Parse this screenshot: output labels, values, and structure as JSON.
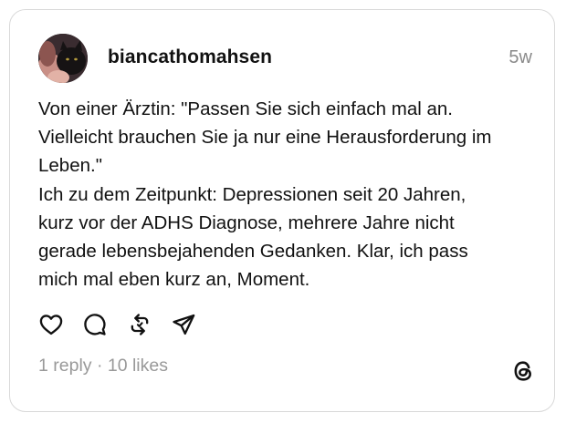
{
  "post": {
    "username": "biancathomahsen",
    "timestamp": "5w",
    "avatar_icon": "profile-photo-cat",
    "text_lines": [
      "Von einer Ärztin: \"Passen Sie sich einfach mal an.",
      "Vielleicht brauchen Sie ja nur eine Herausforderung im",
      "Leben.\"",
      "Ich zu dem Zeitpunkt: Depressionen seit 20 Jahren,",
      "kurz vor der ADHS Diagnose, mehrere Jahre nicht",
      "gerade lebensbejahenden Gedanken. Klar, ich pass",
      "mich mal eben kurz an, Moment."
    ],
    "actions": [
      "heart-icon",
      "comment-icon",
      "repost-icon",
      "share-icon"
    ],
    "stats_text": "1 reply · 10 likes",
    "brand_icon": "threads-logo-icon"
  },
  "colors": {
    "text": "#111111",
    "muted": "#999999",
    "border": "#d9d9d9"
  }
}
